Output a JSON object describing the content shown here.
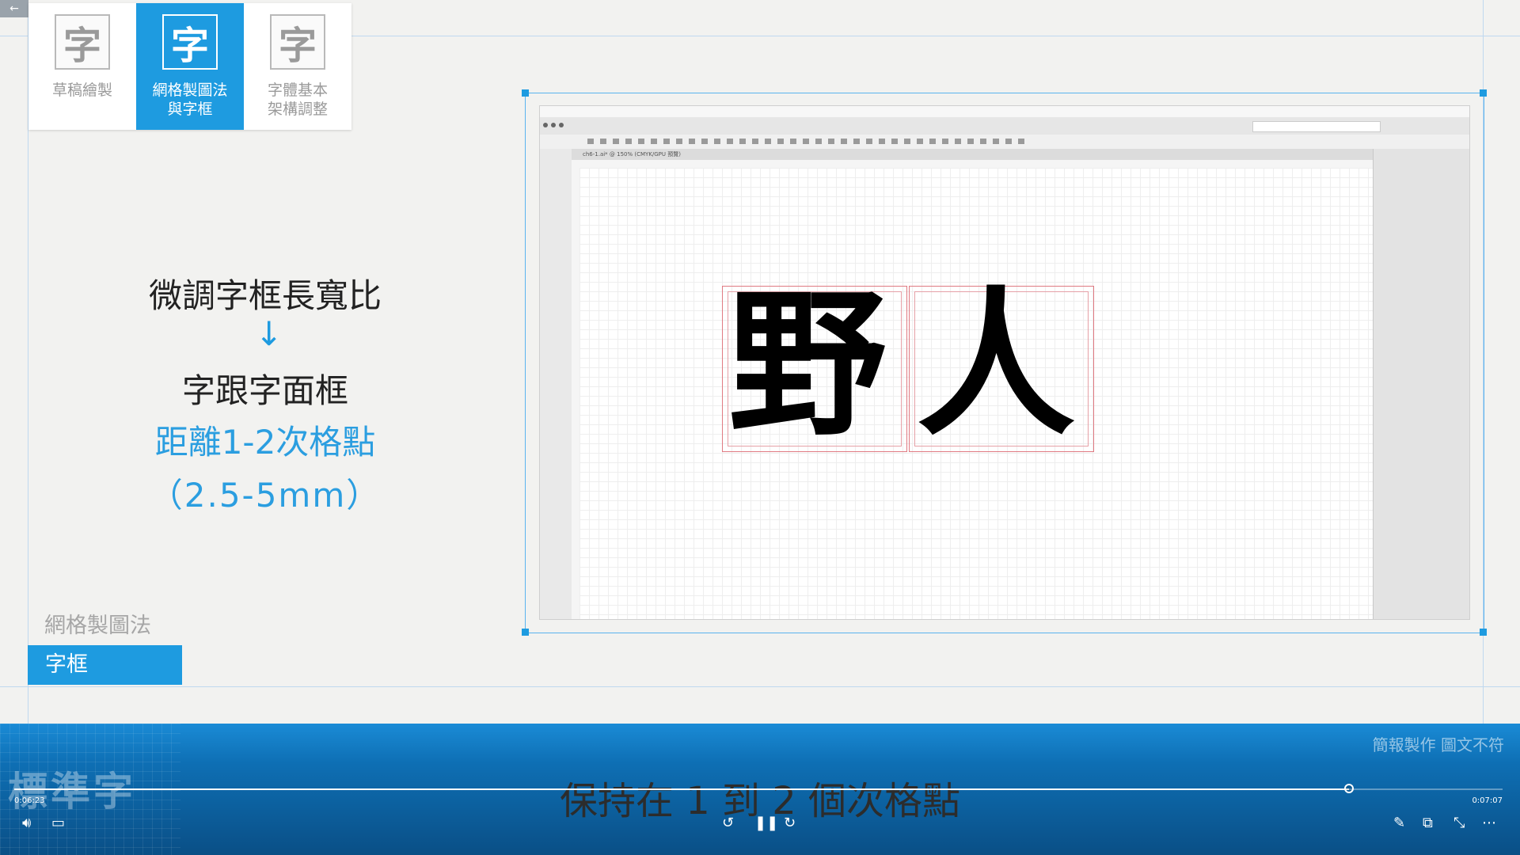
{
  "back_icon": "arrow-left-icon",
  "tabs": [
    {
      "glyph": "字",
      "label": "草稿繪製",
      "active": false
    },
    {
      "glyph": "字",
      "label": "網格製圖法\n與字框",
      "active": true
    },
    {
      "glyph": "字",
      "label": "字體基本\n架構調整",
      "active": false
    }
  ],
  "notes": {
    "line1": "微調字框長寬比",
    "arrow": "↓",
    "line2": "字跟字面框",
    "line3": "距離1-2次格點",
    "line4": "（2.5-5mm）"
  },
  "section": {
    "title": "網格製圖法",
    "tag": "字框"
  },
  "illustrator": {
    "doc_tab": "ch6-1.ai* @ 150% (CMYK/GPU 預覽)",
    "chars": [
      "野",
      "人"
    ]
  },
  "video": {
    "brand": "標準字",
    "watermark": "簡報製作 圖文不符",
    "subtitle": "保持在 1 到 2 個次格點",
    "time_current": "0:06:23",
    "time_total": "0:07:07",
    "progress": 0.897,
    "controls": {
      "volume": "volume-icon",
      "captions": "captions-icon",
      "rewind": "rewind-10-icon",
      "pause": "pause-icon",
      "forward": "forward-30-icon",
      "pen": "pen-icon",
      "pip": "picture-in-picture-icon",
      "fullscreen": "exit-fullscreen-icon",
      "more": "more-icon"
    }
  }
}
